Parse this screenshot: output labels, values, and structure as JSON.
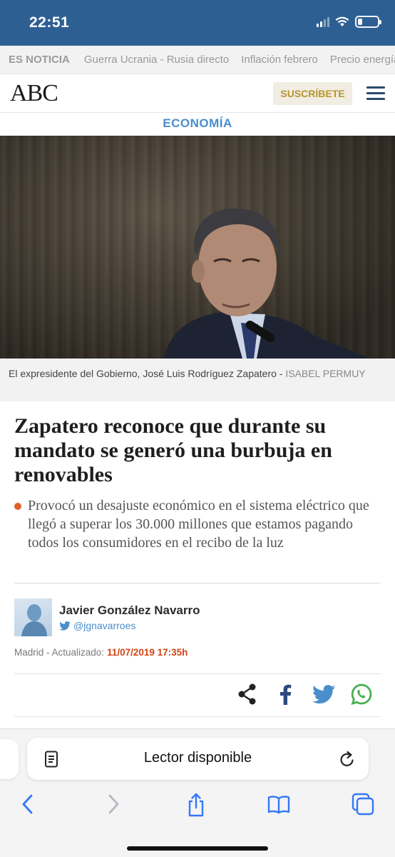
{
  "status": {
    "time": "22:51"
  },
  "topics": {
    "label": "ES NOTICIA",
    "items": [
      "Guerra Ucrania - Rusia directo",
      "Inflación febrero",
      "Precio energía"
    ]
  },
  "header": {
    "logo": "ABC",
    "subscribe_label": "SUSCRÍBETE"
  },
  "section": "ECONOMÍA",
  "photo": {
    "caption": "El expresidente del Gobierno, José Luis Rodríguez Zapatero - ",
    "credit": "ISABEL PERMUY"
  },
  "article": {
    "headline": "Zapatero reconoce que durante su mandato se generó una burbuja en renovables",
    "subhead": "Provocó un desajuste económico en el sistema eléctrico que llegó a superar los 30.000 millones que estamos pagando todos los consumidores en el recibo de la luz"
  },
  "author": {
    "name": "Javier González Navarro",
    "twitter": "@jgnavarroes"
  },
  "dateline": {
    "place": "Madrid",
    "updated_label": " - Actualizado:",
    "date": "11/07/2019 17:35h"
  },
  "share": {
    "icons": [
      "share-icon",
      "facebook-icon",
      "twitter-icon",
      "whatsapp-icon"
    ]
  },
  "browser": {
    "reader_label": "Lector disponible"
  },
  "colors": {
    "status_bar": "#2d5f93",
    "section": "#4a8ecb",
    "accent": "#e3602b",
    "date": "#d04515",
    "subscribe_text": "#b8942f"
  }
}
